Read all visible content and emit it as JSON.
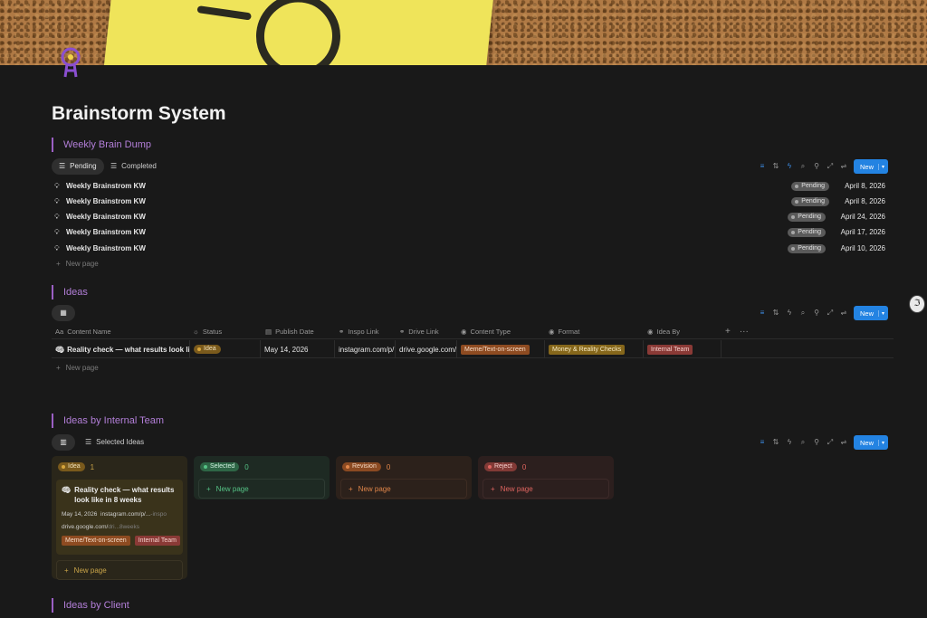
{
  "page": {
    "title": "Brainstorm System"
  },
  "weekly": {
    "heading": "Weekly Brain Dump",
    "tabs": [
      "Pending",
      "Completed"
    ],
    "new_label": "New",
    "rows": [
      {
        "name": "Weekly Brainstrom KW",
        "status": "Pending",
        "date": "April 8, 2026"
      },
      {
        "name": "Weekly Brainstrom KW",
        "status": "Pending",
        "date": "April 8, 2026"
      },
      {
        "name": "Weekly Brainstrom KW",
        "status": "Pending",
        "date": "April 24, 2026"
      },
      {
        "name": "Weekly Brainstrom KW",
        "status": "Pending",
        "date": "April 17, 2026"
      },
      {
        "name": "Weekly Brainstrom KW",
        "status": "Pending",
        "date": "April 10, 2026"
      }
    ],
    "new_page": "New page"
  },
  "ideas": {
    "heading": "Ideas",
    "new_label": "New",
    "columns": [
      "Content Name",
      "Status",
      "Publish Date",
      "Inspo Link",
      "Drive Link",
      "Content Type",
      "Format",
      "Idea By"
    ],
    "row": {
      "name": "Reality check — what results look like",
      "status": "Idea",
      "publish_date": "May 14, 2026",
      "inspo_link": "instagram.com/p/...",
      "drive_link": "drive.google.com/",
      "content_type": "Meme/Text-on-screen",
      "format": "Money & Reality Checks",
      "idea_by": "Internal Team"
    },
    "new_page": "New page"
  },
  "internal": {
    "heading": "Ideas by Internal Team",
    "view_label": "Selected Ideas",
    "new_label": "New",
    "columns": [
      {
        "label": "Idea",
        "count": "1",
        "color": "#d7a53c"
      },
      {
        "label": "Selected",
        "count": "0",
        "color": "#55c285"
      },
      {
        "label": "Revision",
        "count": "0",
        "color": "#e0864a"
      },
      {
        "label": "Reject",
        "count": "0",
        "color": "#e06560"
      }
    ],
    "card": {
      "title": "Reality check — what results look like in 8 weeks",
      "date": "May 14, 2026",
      "inspo": "instagram.com/p/...",
      "inspo_tail": "-inspo",
      "drive": "drive.google.com/",
      "drive_tail": "dri...8weeks",
      "content_type": "Meme/Text-on-screen",
      "idea_by": "Internal Team"
    },
    "new_page": "New page"
  },
  "client": {
    "heading": "Ideas by Client"
  },
  "colors": {
    "accent": "#2383e2",
    "section": "#b37fd9",
    "background": "#191919"
  }
}
